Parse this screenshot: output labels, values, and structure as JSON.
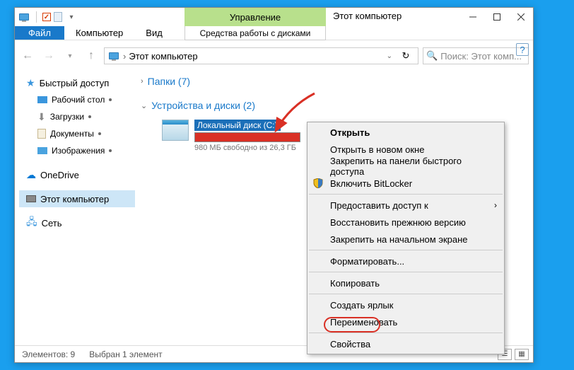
{
  "titlebar": {
    "manage_tab": "Управление",
    "manage_sub": "Средства работы с дисками",
    "title": "Этот компьютер"
  },
  "menu": {
    "file": "Файл",
    "computer": "Компьютер",
    "view": "Вид"
  },
  "addressbar": {
    "location": "Этот компьютер",
    "search_placeholder": "Поиск: Этот комп..."
  },
  "nav": {
    "quick": "Быстрый доступ",
    "desktop": "Рабочий стол",
    "downloads": "Загрузки",
    "documents": "Документы",
    "pictures": "Изображения",
    "onedrive": "OneDrive",
    "thispc": "Этот компьютер",
    "network": "Сеть"
  },
  "groups": {
    "folders": "Папки (7)",
    "devices": "Устройства и диски (2)"
  },
  "drive": {
    "name": "Локальный диск (C:)",
    "free_label": "980 МБ свободно из 26,3 ГБ",
    "free_mb": 980,
    "total_gb": 26.3,
    "bar_pct": 96
  },
  "context": {
    "open": "Открыть",
    "open_new": "Открыть в новом окне",
    "pin_quick": "Закрепить на панели быстрого доступа",
    "bitlocker": "Включить BitLocker",
    "share": "Предоставить доступ к",
    "restore": "Восстановить прежнюю версию",
    "pin_start": "Закрепить на начальном экране",
    "format": "Форматировать...",
    "copy": "Копировать",
    "shortcut": "Создать ярлык",
    "rename": "Переименовать",
    "properties": "Свойства"
  },
  "status": {
    "count": "Элементов: 9",
    "selected": "Выбран 1 элемент"
  }
}
